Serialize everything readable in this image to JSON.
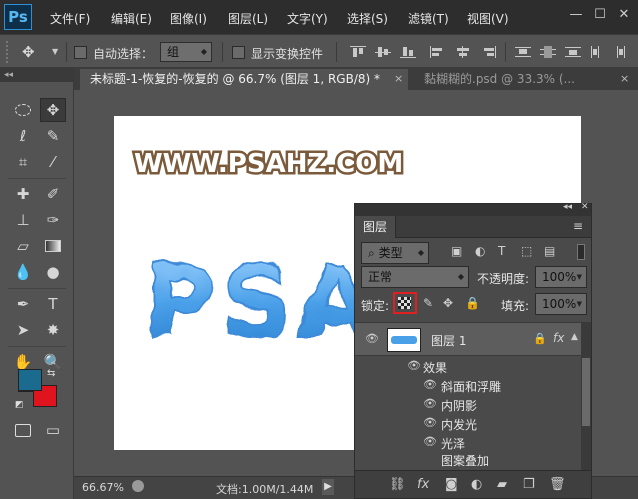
{
  "app": {
    "logo": "Ps"
  },
  "menu": [
    "文件(F)",
    "编辑(E)",
    "图像(I)",
    "图层(L)",
    "文字(Y)",
    "选择(S)",
    "滤镜(T)",
    "视图(V)"
  ],
  "window_controls": {
    "minimize": "—",
    "maximize": "☐",
    "close": "✕"
  },
  "options_bar": {
    "auto_select_label": "自动选择：",
    "auto_select_value": "组",
    "show_transform_label": "显示变换控件"
  },
  "tabs": [
    {
      "title": "未标题-1-恢复的-恢复的 @ 66.7% (图层 1, RGB/8) *",
      "close": "×"
    },
    {
      "title": "黏糊糊的.psd @ 33.3% (...",
      "close": "×"
    }
  ],
  "canvas": {
    "watermark": "WWW.PSAHZ.COM",
    "art_text": "PSAHZ"
  },
  "colors": {
    "foreground": "#1b6b8f",
    "background": "#e0141e",
    "text_stroke": "#7a5a3a",
    "slime": "#4aa0e8"
  },
  "status": {
    "zoom": "66.67%",
    "doc": "文档:1.00M/1.44M"
  },
  "layers_panel": {
    "tab": "图层",
    "filter_kind": "类型",
    "blend_mode": "正常",
    "opacity_label": "不透明度:",
    "opacity": "100%",
    "lock_label": "锁定:",
    "fill_label": "填充:",
    "fill": "100%",
    "layer_name": "图层 1",
    "fx": "fx",
    "effects_label": "效果",
    "effects": [
      "斜面和浮雕",
      "内阴影",
      "内发光",
      "光泽",
      "图案叠加"
    ]
  }
}
